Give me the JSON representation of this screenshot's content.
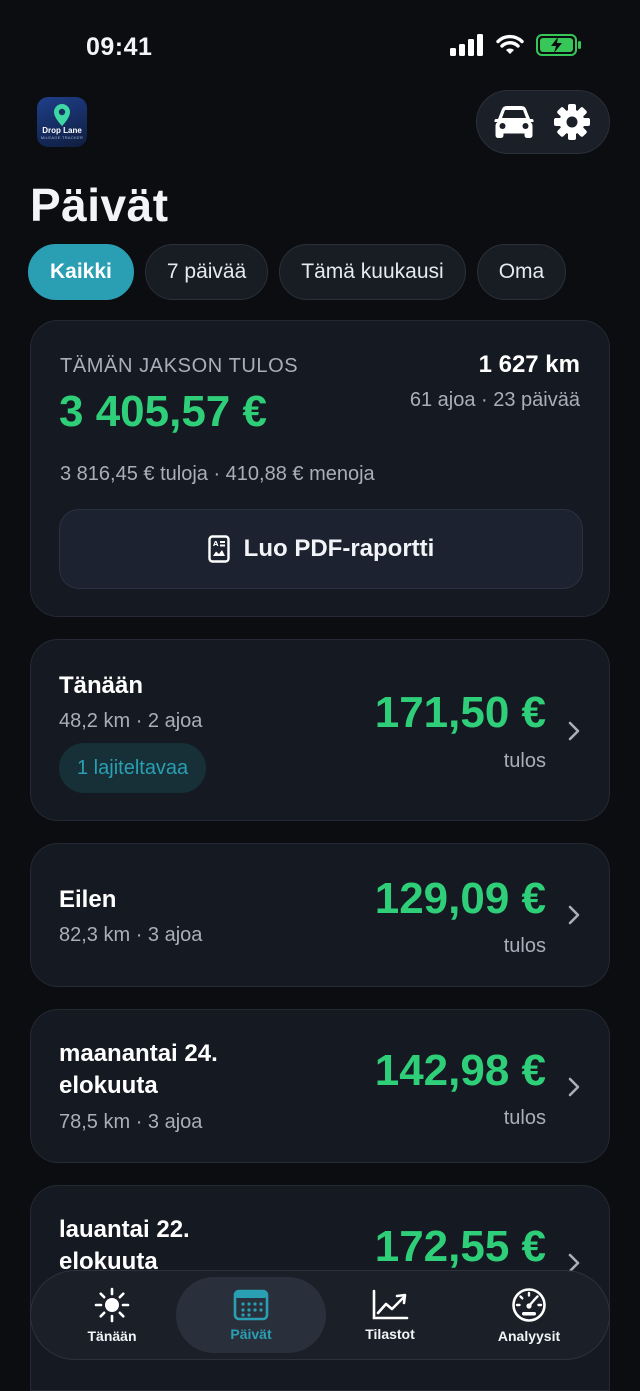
{
  "status_bar": {
    "time": "09:41"
  },
  "app": {
    "logo_text": "Drop Lane",
    "logo_subtext": "MILEAGE TRACKER"
  },
  "header": {
    "title": "Päivät"
  },
  "filters": [
    {
      "label": "Kaikki",
      "active": true
    },
    {
      "label": "7 päivää",
      "active": false
    },
    {
      "label": "Tämä kuukausi",
      "active": false
    },
    {
      "label": "Oma",
      "active": false
    }
  ],
  "summary": {
    "label": "TÄMÄN JAKSON TULOS",
    "amount": "3 405,57 €",
    "distance": "1 627 km",
    "meta": "61 ajoa · 23 päivää",
    "breakdown": "3 816,45 € tuloja · 410,88 € menoja",
    "pdf_button": "Luo PDF-raportti"
  },
  "days": [
    {
      "title": "Tänään",
      "meta": "48,2 km · 2 ajoa",
      "amount": "171,50 €",
      "result": "tulos",
      "tag": "1 lajiteltavaa"
    },
    {
      "title": "Eilen",
      "meta": "82,3 km · 3 ajoa",
      "amount": "129,09 €",
      "result": "tulos"
    },
    {
      "title": "maanantai 24. elokuuta",
      "meta": "78,5 km · 3 ajoa",
      "amount": "142,98 €",
      "result": "tulos"
    },
    {
      "title": "lauantai 22. elokuuta",
      "meta": "",
      "amount": "172,55 €",
      "result": ""
    }
  ],
  "tabbar": [
    {
      "label": "Tänään",
      "icon": "sun-icon",
      "active": false
    },
    {
      "label": "Päivät",
      "icon": "calendar-icon",
      "active": true
    },
    {
      "label": "Tilastot",
      "icon": "line-chart-icon",
      "active": false
    },
    {
      "label": "Analyysit",
      "icon": "speedometer-icon",
      "active": false
    }
  ],
  "colors": {
    "accent": "#2a9fb3",
    "positive": "#2fcf7a",
    "background": "#0b0d11",
    "card": "#151921"
  }
}
